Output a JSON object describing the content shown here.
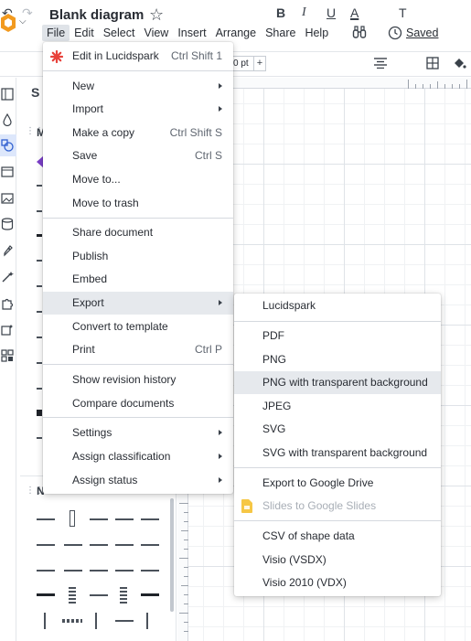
{
  "header": {
    "doc_title": "Blank diagram",
    "saved_label": "Saved"
  },
  "menubar": {
    "items": [
      "File",
      "Edit",
      "Select",
      "View",
      "Insert",
      "Arrange",
      "Share",
      "Help"
    ],
    "active": "File"
  },
  "toolbar": {
    "font_size_value": "0 pt",
    "plus_label": "+",
    "bold_label": "B",
    "italic_label": "I",
    "underline_label": "U",
    "text_color_label": "A",
    "text_options_label": "T"
  },
  "panel": {
    "search_label_partial": "S",
    "section_1_label_partial": "M",
    "section_2_label_partial": "N"
  },
  "file_menu": {
    "items": [
      {
        "label": "Edit in Lucidspark",
        "shortcut": "Ctrl Shift 1",
        "icon": "lucidspark-icon"
      },
      {
        "label": "New",
        "submenu": true
      },
      {
        "label": "Import",
        "submenu": true
      },
      {
        "label": "Make a copy",
        "shortcut": "Ctrl Shift S"
      },
      {
        "label": "Save",
        "shortcut": "Ctrl S"
      },
      {
        "label": "Move to..."
      },
      {
        "label": "Move to trash"
      },
      {
        "label": "Share document"
      },
      {
        "label": "Publish"
      },
      {
        "label": "Embed"
      },
      {
        "label": "Export",
        "submenu": true,
        "highlighted": true
      },
      {
        "label": "Convert to template"
      },
      {
        "label": "Print",
        "shortcut": "Ctrl P"
      },
      {
        "label": "Show revision history"
      },
      {
        "label": "Compare documents"
      },
      {
        "label": "Settings",
        "submenu": true
      },
      {
        "label": "Assign classification",
        "submenu": true
      },
      {
        "label": "Assign status",
        "submenu": true
      }
    ]
  },
  "export_menu": {
    "items": [
      {
        "label": "Lucidspark"
      },
      {
        "label": "PDF"
      },
      {
        "label": "PNG"
      },
      {
        "label": "PNG with transparent background",
        "highlighted": true
      },
      {
        "label": "JPEG"
      },
      {
        "label": "SVG"
      },
      {
        "label": "SVG with transparent background"
      },
      {
        "label": "Export to Google Drive"
      },
      {
        "label": "Slides to Google Slides",
        "disabled": true,
        "icon": "google-slides-icon"
      },
      {
        "label": "CSV of shape data"
      },
      {
        "label": "Visio (VSDX)"
      },
      {
        "label": "Visio 2010 (VDX)"
      }
    ]
  },
  "colors": {
    "menu_highlight": "#e6e9ed",
    "accent_red": "#e8423b",
    "logo_orange": "#f29a1f",
    "disabled_text": "#a8aeb6",
    "slides_yellow": "#f6c745"
  }
}
